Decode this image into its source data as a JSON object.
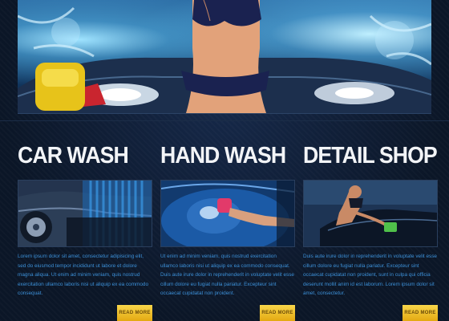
{
  "columns": [
    {
      "title": "CAR WASH",
      "text": "Lorem ipsum dolor sit amet, consectetur adipisicing elit, sed do eiusmod tempor incididunt ut labore et dolore magna aliqua. Ut enim ad minim veniam, quis nostrud exercitation ullamco laboris nisi ut aliquip ex ea commodo consequat.",
      "button": "READ MORE"
    },
    {
      "title": "HAND WASH",
      "text": "Ut enim ad minim veniam, quis nostrud exercitation ullamco laboris nisi ut aliquip ex ea commodo consequat. Duis aute irure dolor in reprehenderit in voluptate velit esse cillum dolore eu fugiat nulla pariatur. Excepteur sint occaecat cupidatat non proident.",
      "button": "READ MORE"
    },
    {
      "title": "DETAIL SHOP",
      "text": "Duis aute irure dolor in reprehenderit in voluptate velit esse cillum dolore eu fugiat nulla pariatur. Excepteur sint occaecat cupidatat non proident, sunt in culpa qui officia deserunt mollit anim id est laborum. Lorem ipsum dolor sit amet, consectetur.",
      "button": "READ MORE"
    }
  ],
  "colors": {
    "background": "#0d1a2c",
    "heading": "#f2f4f7",
    "body_text": "#3c90d8",
    "button": "#f2c230"
  }
}
